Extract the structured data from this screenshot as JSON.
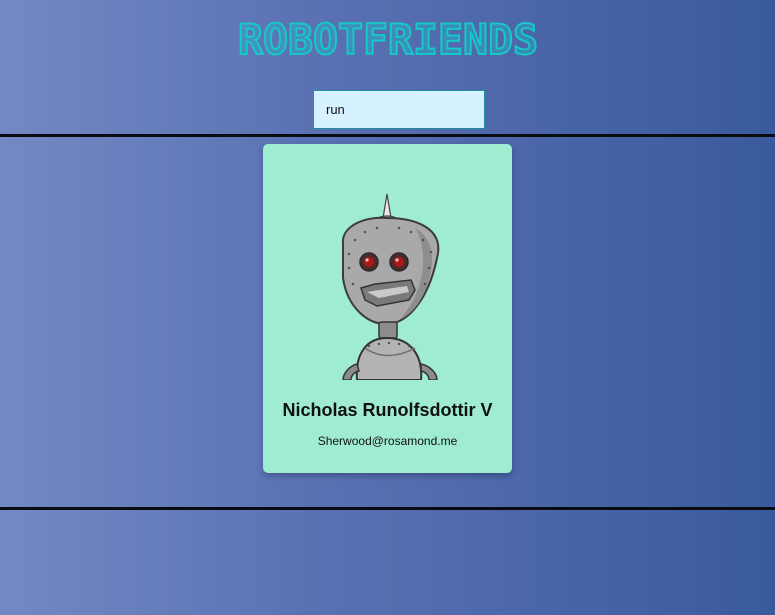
{
  "header": {
    "title": "ROBOTFRIENDS",
    "title_color": "#16c9c9"
  },
  "search": {
    "value": "run",
    "placeholder": "search robots"
  },
  "cards": [
    {
      "name": "Nicholas Runolfsdottir V",
      "email": "Sherwood@rosamond.me",
      "avatar_icon": "robot-avatar"
    }
  ],
  "colors": {
    "background_start": "#7389c4",
    "background_end": "#3a5a9e",
    "card_background": "#9fecd1",
    "search_background": "#d6f1ff"
  }
}
